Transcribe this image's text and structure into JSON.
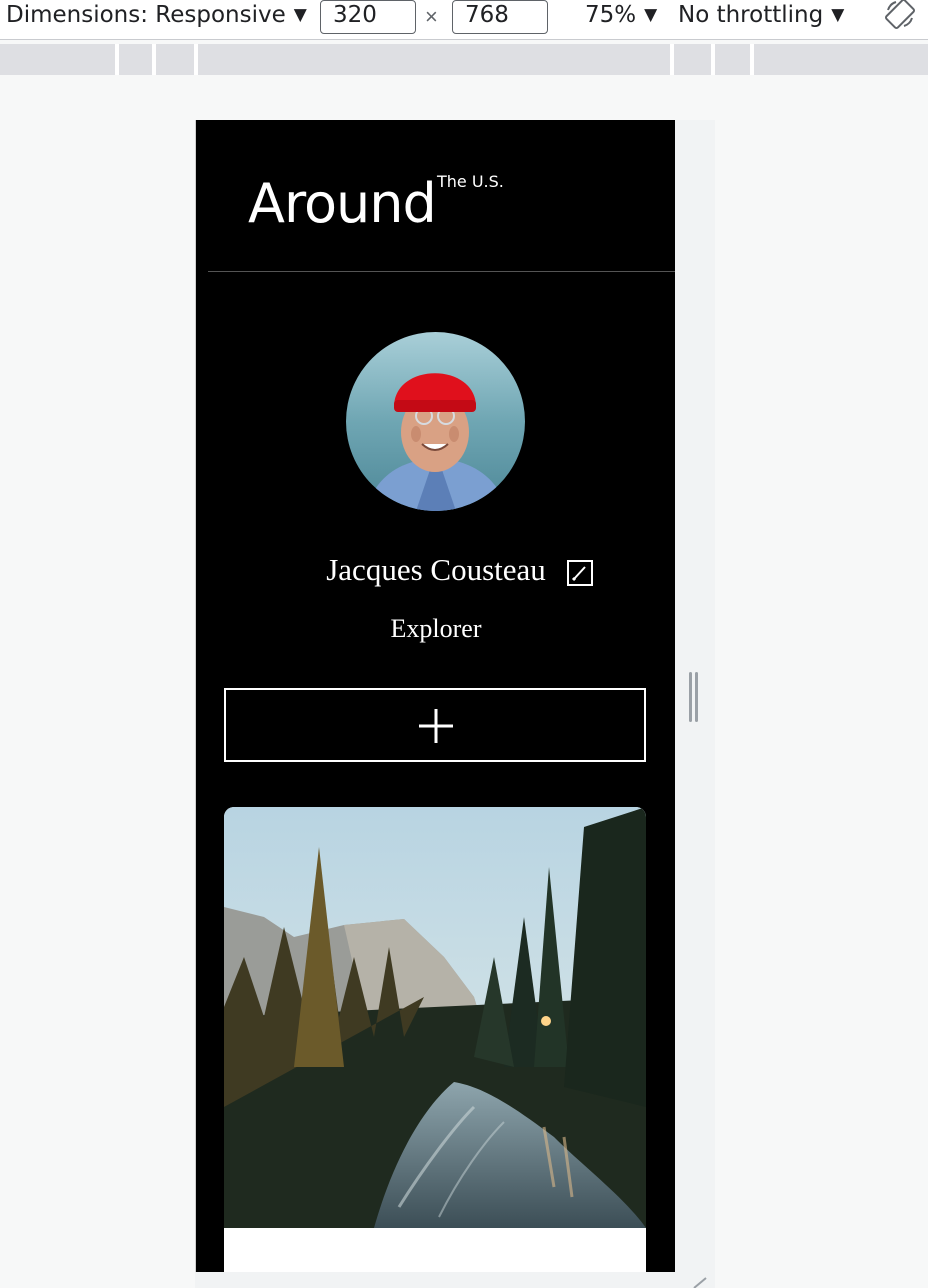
{
  "devtools": {
    "dimensions_label": "Dimensions: Responsive",
    "width_value": "320",
    "height_value": "768",
    "times": "×",
    "zoom": "75%",
    "throttling": "No throttling",
    "arrow": "▼"
  },
  "header": {
    "logo_main": "Around",
    "logo_sub": "The U.S."
  },
  "profile": {
    "name": "Jacques Cousteau",
    "job": "Explorer",
    "avatar_icon": "avatar-photo"
  },
  "colors": {
    "page_bg": "#000000",
    "text": "#ffffff",
    "divider": "#545454"
  }
}
